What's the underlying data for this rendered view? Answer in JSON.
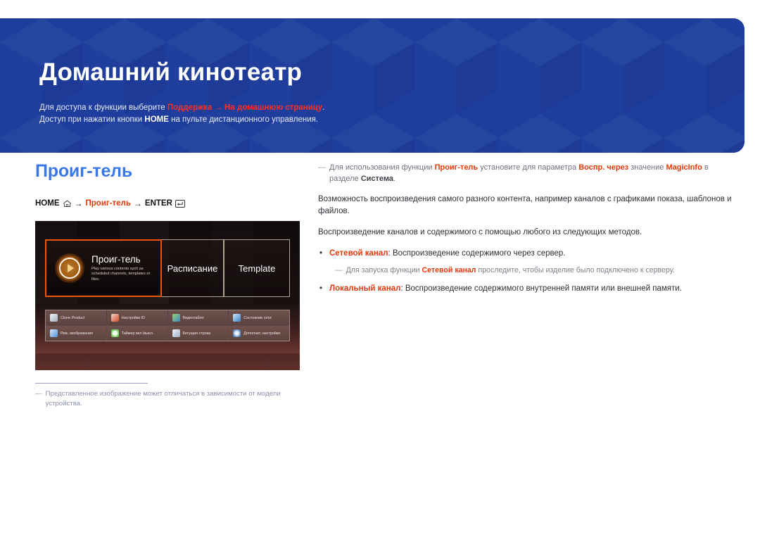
{
  "banner": {
    "title": "Домашний кинотеатр",
    "line1": {
      "pre": "Для доступа к функции выберите ",
      "accent1": "Поддержка",
      "arrow": " → ",
      "accent2": "На домашнюю страницу",
      "post": "."
    },
    "line2": {
      "pre": "Доступ при нажатии кнопки ",
      "bold": "HOME",
      "post": " на пульте дистанционного управления."
    },
    "colors": {
      "bg": "#1f3e9e",
      "accent": "#ff2f1e",
      "text": "#e6eaf6"
    }
  },
  "section": {
    "title": "Проиг-тель",
    "title_color": "#3b78e7",
    "path": {
      "home": "HOME",
      "home_icon": "home-icon",
      "arrow1": "→",
      "target": "Проиг-тель",
      "arrow2": "→",
      "enter": "ENTER",
      "enter_icon": "enter-key-icon"
    }
  },
  "tv_screenshot": {
    "tiles": [
      {
        "title": "Проиг-тель",
        "desc": "Play various contents sych as scheduled channels, templates or files.",
        "icon": "play-circle-icon",
        "selected": true
      },
      {
        "title": "Расписание",
        "selected": false
      },
      {
        "title": "Template",
        "selected": false
      }
    ],
    "grid": [
      {
        "label": "Clone Product",
        "icon": "clone-icon",
        "color": "#dfe4ea"
      },
      {
        "label": "Настройки ID",
        "icon": "id-settings-icon",
        "color": "#e05d3a"
      },
      {
        "label": "Видеотабло",
        "icon": "video-wall-icon",
        "color": "#4f9fd8"
      },
      {
        "label": "Состояние сети",
        "icon": "network-status-icon",
        "color": "#5aa3de"
      },
      {
        "label": "Реж. изображения",
        "icon": "picture-mode-icon",
        "color": "#6aa9e0"
      },
      {
        "label": "Таймер вкл./выкл.",
        "icon": "on-off-timer-icon",
        "color": "#79d36a"
      },
      {
        "label": "Бегущая строка",
        "icon": "ticker-icon",
        "color": "#b9c4d4"
      },
      {
        "label": "Дополнит. настройки",
        "icon": "advanced-settings-gear-icon",
        "color": "#7fa8d4"
      }
    ]
  },
  "footnote": {
    "dash": "―",
    "text": "Представленное изображение может отличаться в зависимости от модели устройства."
  },
  "right": {
    "note1": {
      "dash": "―",
      "p1": "Для использования функции ",
      "b1": "Проиг-тель",
      "p2": " установите для параметра ",
      "b2": "Воспр. через",
      "p3": " значение ",
      "b3": "MagicInfo",
      "p4": " в разделе ",
      "b4": "Система",
      "p5": "."
    },
    "para1": "Возможность воспроизведения самого разного контента, например каналов с графиками показа, шаблонов и файлов.",
    "para2": "Воспроизведение каналов и содержимого с помощью любого из следующих методов.",
    "bullet1": {
      "dot": "•",
      "label": "Сетевой канал",
      "text": ": Воспроизведение содержимого через сервер."
    },
    "subnote1": {
      "dash": "―",
      "p1": "Для запуска функции ",
      "b1": "Сетевой канал",
      "p2": " проследите, чтобы изделие было подключено к серверу."
    },
    "bullet2": {
      "dot": "•",
      "label": "Локальный канал",
      "text": ": Воспроизведение содержимого внутренней памяти или внешней памяти."
    }
  }
}
